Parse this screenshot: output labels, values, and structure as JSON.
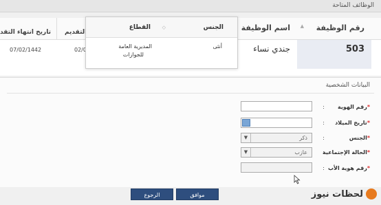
{
  "header": {
    "title": "الوظائف المتاحة"
  },
  "jobs_table": {
    "columns": {
      "job_number": "رقم الوظيفة",
      "job_name": "اسم الوظيفة",
      "gender": "الجنس",
      "sector": "القطاع",
      "apply": "التقديم",
      "end_date": "تاريخ انتهاء التقد"
    },
    "row": {
      "job_number": "503",
      "job_name": "جندي نساء",
      "gender": "أنثى",
      "sector_line1": "المديرية العامة",
      "sector_line2": "للجوازات",
      "apply": "02/0",
      "end_date": "07/02/1442"
    }
  },
  "personal": {
    "title": "البيانات الشخصية",
    "fields": [
      {
        "label": "رقم الهوية",
        "value": ""
      },
      {
        "label": "تاريخ الميلاد",
        "value": ""
      },
      {
        "label": "الجنس",
        "value": "ذكر"
      },
      {
        "label": "الحالة الإجتماعية",
        "value": "عازب"
      },
      {
        "label": "رقم هوية الأب",
        "value": ""
      }
    ],
    "colon": ":",
    "required_mark": "*"
  },
  "buttons": {
    "ok": "موافق",
    "back": "الرجوع"
  },
  "logo": {
    "text": "لحظات نيوز"
  },
  "icons": {
    "calendar": "calendar-icon",
    "dropdown": "chevron-down-icon",
    "sort": "sort-icon",
    "cursor": "cursor-icon"
  },
  "colors": {
    "button": "#2e4e7e",
    "logo_accent": "#e77a1e",
    "required": "#dd3333"
  }
}
